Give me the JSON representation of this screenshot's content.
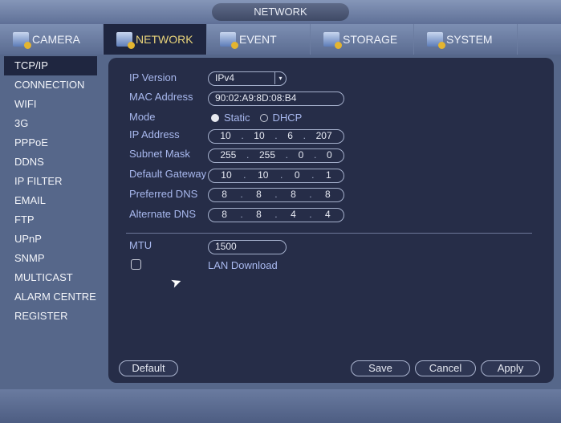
{
  "title": "NETWORK",
  "tabs": [
    {
      "label": "CAMERA",
      "icon": "camera-icon"
    },
    {
      "label": "NETWORK",
      "icon": "network-icon"
    },
    {
      "label": "EVENT",
      "icon": "event-icon"
    },
    {
      "label": "STORAGE",
      "icon": "storage-icon"
    },
    {
      "label": "SYSTEM",
      "icon": "system-icon"
    }
  ],
  "sidebar": [
    "TCP/IP",
    "CONNECTION",
    "WIFI",
    "3G",
    "PPPoE",
    "DDNS",
    "IP FILTER",
    "EMAIL",
    "FTP",
    "UPnP",
    "SNMP",
    "MULTICAST",
    "ALARM CENTRE",
    "REGISTER"
  ],
  "form": {
    "ip_version_label": "IP Version",
    "ip_version": "IPv4",
    "mac_label": "MAC Address",
    "mac": "90:02:A9:8D:08:B4",
    "mode_label": "Mode",
    "mode_static": "Static",
    "mode_dhcp": "DHCP",
    "ip_label": "IP Address",
    "ip": [
      "10",
      "10",
      "6",
      "207"
    ],
    "mask_label": "Subnet Mask",
    "mask": [
      "255",
      "255",
      "0",
      "0"
    ],
    "gw_label": "Default Gateway",
    "gw": [
      "10",
      "10",
      "0",
      "1"
    ],
    "dns1_label": "Preferred DNS",
    "dns1": [
      "8",
      "8",
      "8",
      "8"
    ],
    "dns2_label": "Alternate DNS",
    "dns2": [
      "8",
      "8",
      "4",
      "4"
    ],
    "mtu_label": "MTU",
    "mtu": "1500",
    "lan_download": "LAN Download"
  },
  "buttons": {
    "default": "Default",
    "save": "Save",
    "cancel": "Cancel",
    "apply": "Apply"
  }
}
